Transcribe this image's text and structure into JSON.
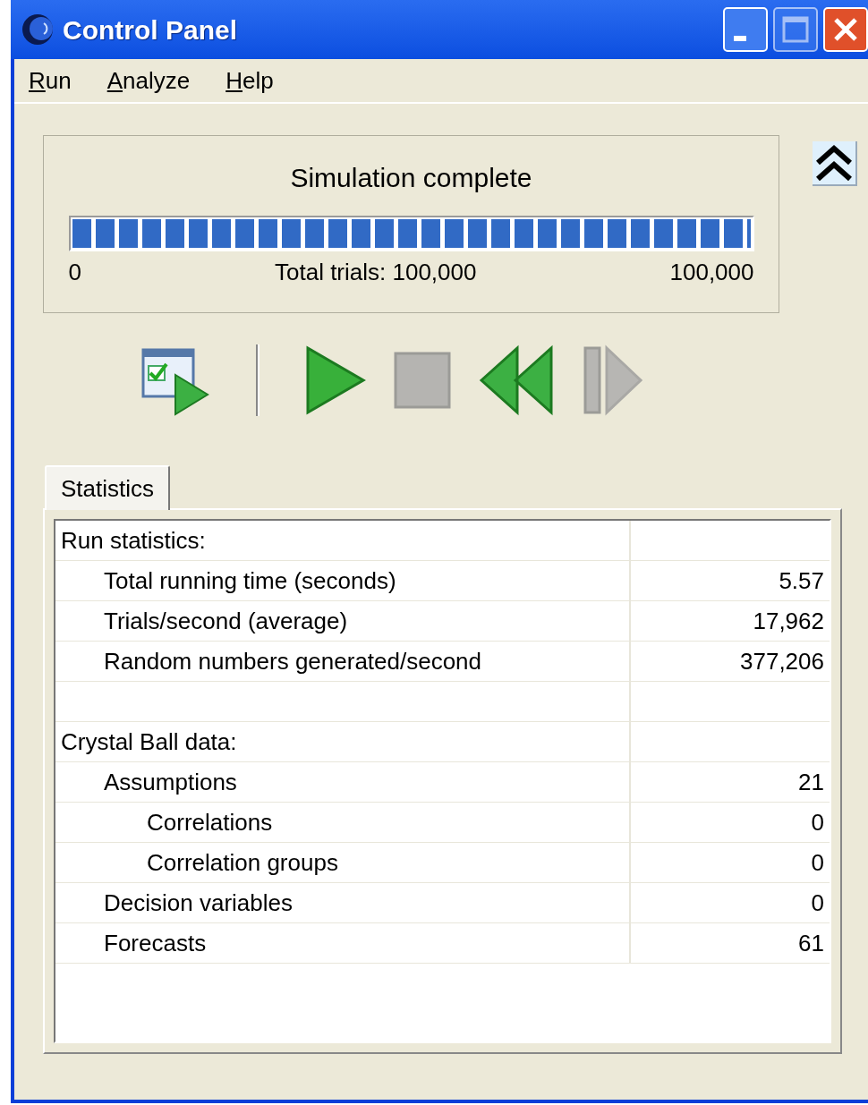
{
  "window": {
    "title": "Control Panel",
    "controls": [
      {
        "kind": "minimize",
        "disabled": false
      },
      {
        "kind": "maximize",
        "disabled": true
      },
      {
        "kind": "close",
        "disabled": false
      }
    ]
  },
  "menu": [
    {
      "key": "R",
      "rest": "un"
    },
    {
      "key": "A",
      "rest": "nalyze"
    },
    {
      "key": "H",
      "rest": "elp"
    }
  ],
  "progress": {
    "status": "Simulation complete",
    "level": 1,
    "min_label": "0",
    "center_label": "Total trials: 100,000",
    "max_label": "100,000"
  },
  "toolbar": [
    {
      "kind": "setup",
      "disabled": false
    },
    {
      "kind": "separator"
    },
    {
      "kind": "run",
      "disabled": false
    },
    {
      "kind": "stop",
      "disabled": true
    },
    {
      "kind": "reset",
      "disabled": false
    },
    {
      "kind": "step",
      "disabled": true
    }
  ],
  "tabs": [
    {
      "label": "Statistics",
      "selected": true
    }
  ],
  "table": {
    "rows": [
      {
        "kind": "section",
        "label": "Run statistics:",
        "children": [
          {
            "kind": "item",
            "label": "Total running time (seconds)",
            "value": "5.57"
          },
          {
            "kind": "item",
            "label": "Trials/second (average)",
            "value": "17,962"
          },
          {
            "kind": "item",
            "label": "Random numbers generated/second",
            "value": "377,206"
          }
        ]
      },
      {
        "kind": "spacer"
      },
      {
        "kind": "section",
        "label": "Crystal Ball data:",
        "children": [
          {
            "kind": "item",
            "label": "Assumptions",
            "value": "21",
            "children": [
              {
                "kind": "item",
                "label": "Correlations",
                "value": "0"
              },
              {
                "kind": "item",
                "label": "Correlation groups",
                "value": "0"
              }
            ]
          },
          {
            "kind": "item",
            "label": "Decision variables",
            "value": "0"
          },
          {
            "kind": "item",
            "label": "Forecasts",
            "value": "61"
          }
        ]
      }
    ]
  }
}
